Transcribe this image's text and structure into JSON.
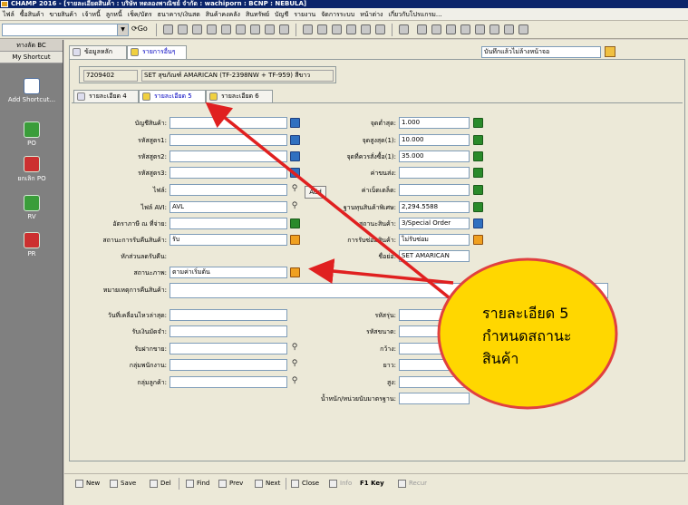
{
  "window": {
    "title": "CHAMP 2016 - [รายละเอียดสินค้า : บริษัท ทดลองพาณิชย์ จำกัด : wachiporn : BCNP : NEBULA]"
  },
  "menu": [
    "ไฟล์",
    "ซื้อสินค้า",
    "ขายสินค้า",
    "เจ้าหนี้",
    "ลูกหนี้",
    "เช็ค/บัตร",
    "ธนาคาร/เงินสด",
    "สินค้าคงคลัง",
    "สินทรัพย์",
    "บัญชี",
    "รายงาน",
    "จัดการระบบ",
    "หน้าต่าง",
    "เกี่ยวกับโปรแกรม..."
  ],
  "toolbar": {
    "go_label": "Go"
  },
  "sidebar": {
    "header": "ทางลัด BC",
    "shortcut_title": "My Shortcut",
    "items": [
      {
        "label": "Add Shortcut...",
        "icon": "add-shortcut-icon"
      },
      {
        "label": "PO",
        "icon": "po-icon"
      },
      {
        "label": "ยกเลิก PO",
        "icon": "cancel-po-icon"
      },
      {
        "label": "RV",
        "icon": "rv-icon"
      },
      {
        "label": "PR",
        "icon": "pr-icon"
      }
    ]
  },
  "top_tabs": [
    "ข้อมูลหลัก",
    "รายการอื่นๆ"
  ],
  "note_field": "บันทึกแล้วไม่ล้างหน้าจอ",
  "header": {
    "code": "7209402",
    "name": "SET สุขภัณฑ์ AMARICAN (TF-2398NW + TF-959) สีขาว"
  },
  "sub_tabs": [
    "รายละเอียด 4",
    "รายละเอียด 5",
    "รายละเอียด 6"
  ],
  "left_fields": {
    "account": {
      "label": "บัญชีสินค้า:",
      "value": ""
    },
    "code1": {
      "label": "รหัสสูตร1:",
      "value": ""
    },
    "code2": {
      "label": "รหัสสูตร2:",
      "value": ""
    },
    "code3": {
      "label": "รหัสสูตร3:",
      "value": ""
    },
    "file": {
      "label": "ไฟล์:",
      "value": ""
    },
    "avi": {
      "label": "ไฟล์ AVI:",
      "value": "AVL"
    },
    "tax": {
      "label": "อัตราภาษี ณ ที่จ่าย:",
      "value": ""
    },
    "receive_status": {
      "label": "สถานะการรับคืนสินค้า:",
      "value": "รับ"
    },
    "deduct": {
      "label": "หักส่วนลดรับคืน:",
      "value": ""
    },
    "status": {
      "label": "สถานะภาพ:",
      "value": "ตามค่าเริ่มต้น"
    },
    "remark": {
      "label": "หมายเหตุการคืนสินค้า:",
      "value": ""
    },
    "last_move": {
      "label": "วันที่เคลื่อนไหวล่าสุด:",
      "value": ""
    },
    "deposit": {
      "label": "รับเงินมัดจำ:",
      "value": ""
    },
    "receive_tax": {
      "label": "รับฝากขาย:",
      "value": ""
    },
    "group_work": {
      "label": "กลุ่มพนักงาน:",
      "value": ""
    },
    "group_customer": {
      "label": "กลุ่มลูกค้า:",
      "value": ""
    }
  },
  "right_fields": {
    "min": {
      "label": "จุดต่ำสุด:",
      "value": "1.000"
    },
    "max": {
      "label": "จุดสูงสุด(1):",
      "value": "10.000"
    },
    "reorder": {
      "label": "จุดที่ควรสั่งซื้อ(1):",
      "value": "35.000"
    },
    "shipping": {
      "label": "ค่าขนส่ง:",
      "value": ""
    },
    "storage": {
      "label": "ค่าเบ็ดเตล็ด:",
      "value": ""
    },
    "special_cost": {
      "label": "ฐานทุนสินค้าพิเศษ:",
      "value": "2,294.5588"
    },
    "item_status": {
      "label": "สถานะสินค้า:",
      "value": "3/Special Order"
    },
    "repair": {
      "label": "การรับซ่อมสินค้า:",
      "value": "ไม่รับซ่อม"
    },
    "short_name": {
      "label": "ชื่อย่อ:",
      "value": "SET AMARICAN"
    },
    "color": {
      "label": "รหัสรุ่น:",
      "value": ""
    },
    "size": {
      "label": "รหัสขนาด:",
      "value": ""
    },
    "width": {
      "label": "กว้าง:",
      "value": ""
    },
    "length": {
      "label": "ยาว:",
      "value": ""
    },
    "height": {
      "label": "สูง:",
      "value": ""
    },
    "weight": {
      "label": "น้ำหนัก/หน่วยนับมาตรฐาน:",
      "value": ""
    }
  },
  "tooltip": "Add",
  "bottom_buttons": [
    "New",
    "Save",
    "Del",
    "Find",
    "Prev",
    "Next",
    "Close",
    "Info",
    "F1 Key",
    "Recur"
  ],
  "callout": {
    "line1": "รายละเอียด 5",
    "line2": "กำหนดสถานะ",
    "line3": "สินค้า"
  },
  "colors": {
    "callout_fill": "#ffd700",
    "callout_border": "#e04040",
    "arrow": "#e02020",
    "active_tab": "#0000c0"
  }
}
